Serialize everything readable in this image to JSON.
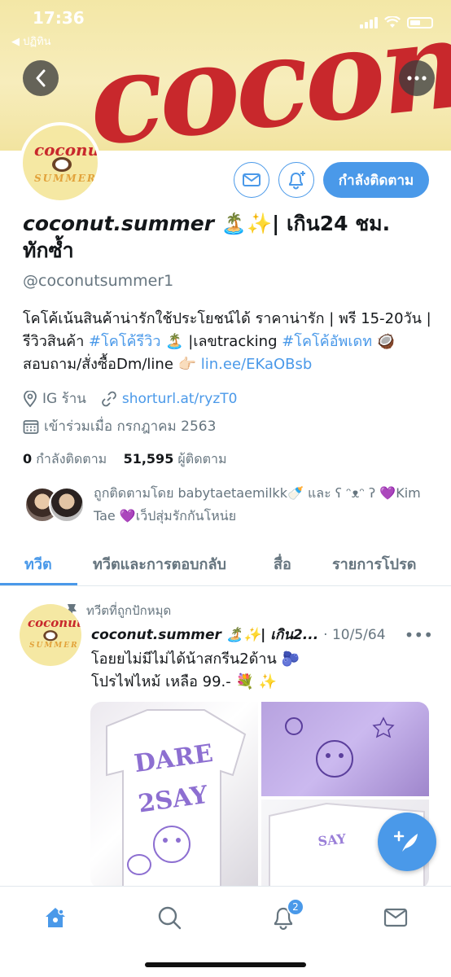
{
  "status_bar": {
    "time": "17:36",
    "back_app": "◀ ปฏิทิน"
  },
  "banner": {
    "word": "coconut"
  },
  "avatar": {
    "line1": "coconut",
    "line2": "SUMMER"
  },
  "actions": {
    "follow_label": "กำลังติดตาม"
  },
  "profile": {
    "name_main": "coconut.summer",
    "name_suffix": "| เกิน24 ชม.",
    "name_line2": "ทักซ้ำ",
    "emoji_island": "🏝️",
    "emoji_sparkle": "✨",
    "handle": "@coconutsummer1",
    "bio_part1": "โคโค้เน้นสินค้าน่ารักใช้ประโยชน์ได้ ราคาน่ารัก | พรี 15-20วัน |รีวิวสินค้า ",
    "bio_tag1": "#โคโค้รีวิว",
    "bio_part2": " 🏝️ |เลขtracking ",
    "bio_tag2": "#โคโค้อัพเดท",
    "bio_part3": " 🥥 สอบถาม/สั่งซื้อDm/line 👉🏻 ",
    "bio_link": "lin.ee/EKaOBsb",
    "location": "IG ร้าน",
    "website": "shorturl.at/ryzT0",
    "joined": "เข้าร่วมเมื่อ กรกฎาคม 2563",
    "following_count": "0",
    "following_label": "กำลังติดตาม",
    "followers_count": "51,595",
    "followers_label": "ผู้ติดตาม",
    "followed_by": "ถูกติดตามโดย babytaetaemilkk🍼 และ ʕ ᵔᴥᵔ ʔ 💜Kim Tae 💜เว็ปสุ่มรักกันโหน่ย"
  },
  "tabs": [
    "ทวีต",
    "ทวีตและการตอบกลับ",
    "สื่อ",
    "รายการโปรด"
  ],
  "tweet": {
    "pinned_label": "ทวีตที่ถูกปักหมุด",
    "name": "coconut.summer 🏝️✨| เกิน2...",
    "date": "· 10/5/64",
    "text_line1": "โอยยไม่มีไม่ได้น้าสกรีน2ด้าน 🫐",
    "text_line2": "โปรไฟไหม้ เหลือ 99.- 💐 ✨"
  },
  "nav": {
    "notifications_badge": "2"
  },
  "colors": {
    "accent": "#4a99e9",
    "banner_red": "#c8282c",
    "banner_bg": "#f3e7a6"
  }
}
